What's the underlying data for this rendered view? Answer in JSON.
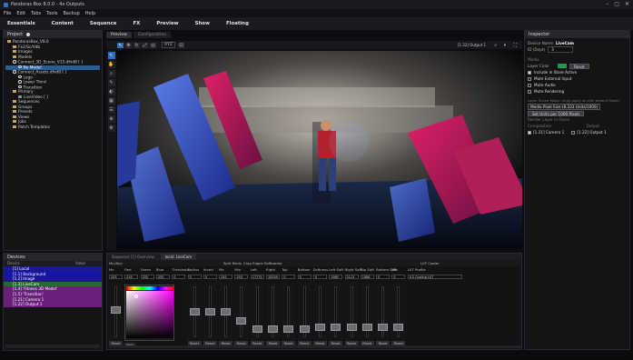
{
  "window": {
    "title": "Pandoras Box 8.0.0 - 4x Outputs"
  },
  "menubar": [
    "File",
    "Edit",
    "Tabs",
    "Tools",
    "Backup",
    "Help"
  ],
  "main_menu": [
    "Essentials",
    "Content",
    "Sequence",
    "FX",
    "Preview",
    "Show",
    "Floating"
  ],
  "project": {
    "header": "Project",
    "items": [
      {
        "label": "PandorasBox_V8.0",
        "indent": 0,
        "kind": "folder"
      },
      {
        "label": "Fx2/Sc/Vdb",
        "indent": 1,
        "kind": "folder"
      },
      {
        "label": "Images",
        "indent": 1,
        "kind": "folder"
      },
      {
        "label": "Models",
        "indent": 1,
        "kind": "folder"
      },
      {
        "label": "Connect_3D_Scene_V15.dfxd8 [ ]",
        "indent": 1,
        "kind": "circle"
      },
      {
        "label": "No Model",
        "indent": 2,
        "kind": "circle",
        "selected": true
      },
      {
        "label": "Connect_Assets.dfxd8 [ ]",
        "indent": 1,
        "kind": "circle"
      },
      {
        "label": "Logo",
        "indent": 2,
        "kind": "circle"
      },
      {
        "label": "Lower Third",
        "indent": 2,
        "kind": "circle"
      },
      {
        "label": "Transition",
        "indent": 2,
        "kind": "circle"
      },
      {
        "label": "Primary",
        "indent": 1,
        "kind": "folder"
      },
      {
        "label": "LiveVideo [ ]",
        "indent": 2,
        "kind": "file"
      },
      {
        "label": "Sequences",
        "indent": 1,
        "kind": "folder"
      },
      {
        "label": "Groups",
        "indent": 1,
        "kind": "folder"
      },
      {
        "label": "Presets",
        "indent": 1,
        "kind": "folder"
      },
      {
        "label": "Views",
        "indent": 1,
        "kind": "folder"
      },
      {
        "label": "Jobs",
        "indent": 1,
        "kind": "folder"
      },
      {
        "label": "Patch Templates",
        "indent": 1,
        "kind": "folder"
      }
    ]
  },
  "devices": {
    "header": "Devices",
    "col_device": "Device",
    "col_value": "Value",
    "items": [
      {
        "label": "[1] Local",
        "color": "#1a1a8c"
      },
      {
        "label": "[1.1] Background",
        "color": "#1414a8"
      },
      {
        "label": "[1.2] Image",
        "color": "#1a1a8c"
      },
      {
        "label": "[1.3] LiveCam",
        "color": "#1f6e2a"
      },
      {
        "label": "[1.4] 'Fitness 3D Model'",
        "color": "#6a1f7a"
      },
      {
        "label": "[1.5] 'Transition'",
        "color": "#6a1f7a"
      },
      {
        "label": "[1.21] Camera 1",
        "color": "#6a1f7a"
      },
      {
        "label": "[1.22] Output 1",
        "color": "#6a1f7a"
      }
    ]
  },
  "preview": {
    "tabs": [
      {
        "label": "Preview",
        "active": true
      },
      {
        "label": "Configuration",
        "active": false
      }
    ],
    "toolbar_mode": "XYZ",
    "output_select": "[1.22] Output 1"
  },
  "inspector": {
    "header": "Inspector",
    "device_name_label": "Device Name",
    "device_name": "LiveCam",
    "id_label": "ID (Dept)",
    "id_value": "3",
    "section_media": "Media",
    "layer_color_label": "Layer Color",
    "reset": "Reset",
    "checks": [
      {
        "label": "Include in Store Active",
        "on": true
      },
      {
        "label": "Mute External Input",
        "on": false
      },
      {
        "label": "Mute Audio",
        "on": false
      },
      {
        "label": "Mute Rendering",
        "on": false
      }
    ],
    "units_note": "Layer Scene Mode: Units apply as with default Model",
    "pixel_size": "Media Pixel Size (8.333 Units/1000)",
    "set_units": "Set Units per 1000 Pixels",
    "render_faces": "Render Layer in Faces",
    "composition": "Composition",
    "output_col": "Output",
    "comp_items": [
      {
        "label": "[1.21] Camera 1",
        "on": true
      },
      {
        "label": "[1.22] Output 1",
        "on": false
      }
    ]
  },
  "mixer": {
    "tabs": [
      {
        "label": "Sequence [1] Overview",
        "active": false
      },
      {
        "label": "local: LiveCam",
        "active": true
      }
    ],
    "groups": [
      "Mix/Key",
      "Split Rects",
      "Crop Edges Softborder",
      "LUT Cooler"
    ],
    "columns": [
      "Mx",
      "Red",
      "Green",
      "Blue",
      "Threshold",
      "Radius",
      "Invert",
      "Mx",
      "Mix",
      "Left",
      "Right",
      "Top",
      "Bottom",
      "Softness",
      "Left Soft",
      "Right Soft",
      "Top Soft",
      "Bottom Soft",
      "Mix",
      "LUT Profile"
    ],
    "values": [
      "255",
      "255",
      "255",
      "255",
      "0",
      "5",
      "0",
      "255",
      "255",
      "17775",
      "33559",
      "0",
      "0",
      "0",
      "1960",
      "2113",
      "1886",
      "0",
      "0",
      "0.5 Cooling LUT"
    ],
    "fader_levels": [
      0.55,
      0.5,
      0.5,
      0.5,
      0.3,
      0.1,
      0.1,
      0.1,
      0.1,
      0.15,
      0.15,
      0.15,
      0.15,
      0.15,
      0.15,
      0.15,
      0.15,
      0.15,
      0.15
    ],
    "reset": "Reset",
    "pick_label": "Pick"
  },
  "colors": {
    "accent": "#2b6fbf",
    "selection": "#2c5d92",
    "local_blue": "#1a1a8c",
    "green": "#1f6e2a",
    "purple": "#6a1f7a"
  }
}
